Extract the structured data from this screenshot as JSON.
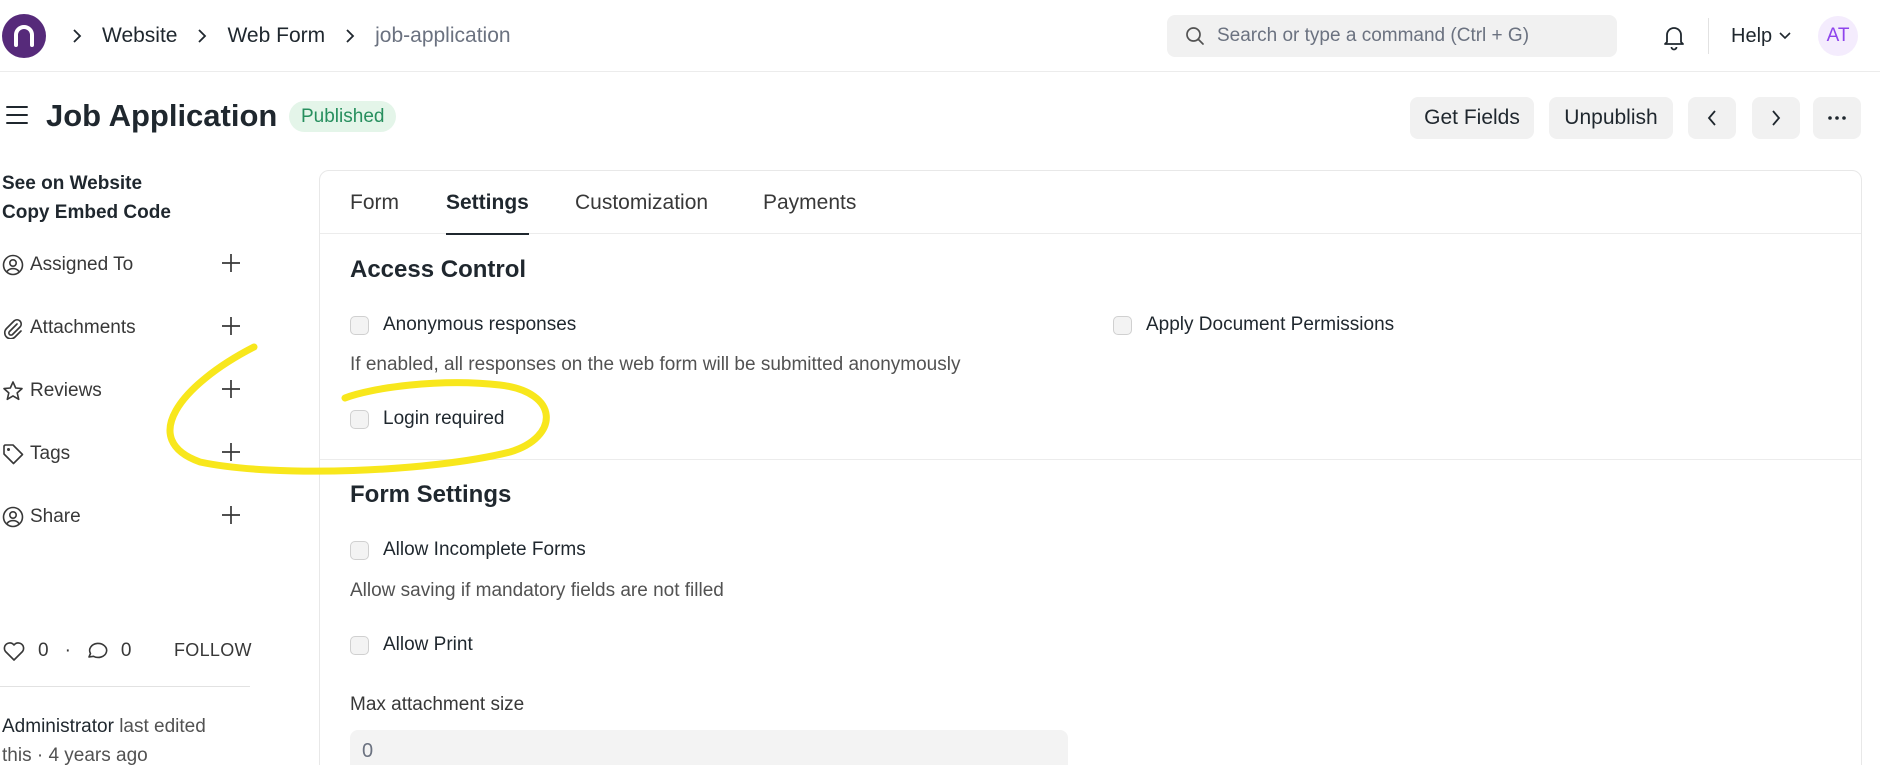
{
  "breadcrumbs": [
    "Website",
    "Web Form",
    "job-application"
  ],
  "search": {
    "placeholder": "Search or type a command (Ctrl + G)"
  },
  "navbar": {
    "help_label": "Help",
    "avatar_initials": "AT"
  },
  "page": {
    "title": "Job Application",
    "status": "Published"
  },
  "actions": {
    "get_fields": "Get Fields",
    "unpublish": "Unpublish"
  },
  "sidebar": {
    "links": [
      "See on Website",
      "Copy Embed Code"
    ],
    "items": [
      {
        "label": "Assigned To",
        "icon": "user-check-icon"
      },
      {
        "label": "Attachments",
        "icon": "paperclip-icon"
      },
      {
        "label": "Reviews",
        "icon": "star-icon"
      },
      {
        "label": "Tags",
        "icon": "tag-icon"
      },
      {
        "label": "Share",
        "icon": "user-check-icon"
      }
    ],
    "likes": "0",
    "comments": "0",
    "follow": "FOLLOW",
    "edited_by": "Administrator",
    "edited_text": "last edited",
    "edited_time": "this · 4 years ago"
  },
  "tabs": [
    "Form",
    "Settings",
    "Customization",
    "Payments"
  ],
  "active_tab": "Settings",
  "access_control": {
    "title": "Access Control",
    "anonymous": "Anonymous responses",
    "anonymous_desc": "If enabled, all responses on the web form will be submitted anonymously",
    "apply_permissions": "Apply Document Permissions",
    "login_required": "Login required"
  },
  "form_settings": {
    "title": "Form Settings",
    "allow_incomplete": "Allow Incomplete Forms",
    "allow_incomplete_desc": "Allow saving if mandatory fields are not filled",
    "allow_print": "Allow Print",
    "max_attachment_label": "Max attachment size",
    "max_attachment_value": "0"
  },
  "colors": {
    "brand": "#562a7a",
    "published": "#278f5e",
    "annotation": "#f8e71c"
  }
}
